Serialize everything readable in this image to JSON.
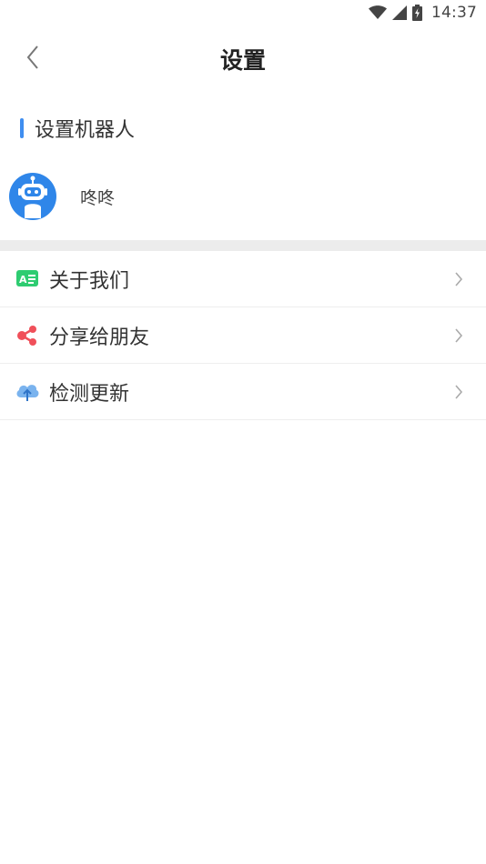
{
  "status_bar": {
    "time": "14:37",
    "icons": [
      "wifi-icon",
      "signal-icon",
      "battery-charging-icon"
    ]
  },
  "nav": {
    "title": "设置",
    "back_icon": "chevron-left-icon"
  },
  "robot_section": {
    "title": "设置机器人",
    "accent_color": "#3f8ef0",
    "robot": {
      "name": "咚咚",
      "avatar_icon": "robot-icon",
      "avatar_color": "#2f86e9"
    }
  },
  "menu": {
    "items": [
      {
        "label": "关于我们",
        "icon": "about-card-icon",
        "icon_color": "#2ecc71"
      },
      {
        "label": "分享给朋友",
        "icon": "share-icon",
        "icon_color": "#f0505a"
      },
      {
        "label": "检测更新",
        "icon": "cloud-upload-icon",
        "icon_color": "#4a9be8"
      }
    ],
    "chevron_icon": "chevron-right-icon"
  }
}
